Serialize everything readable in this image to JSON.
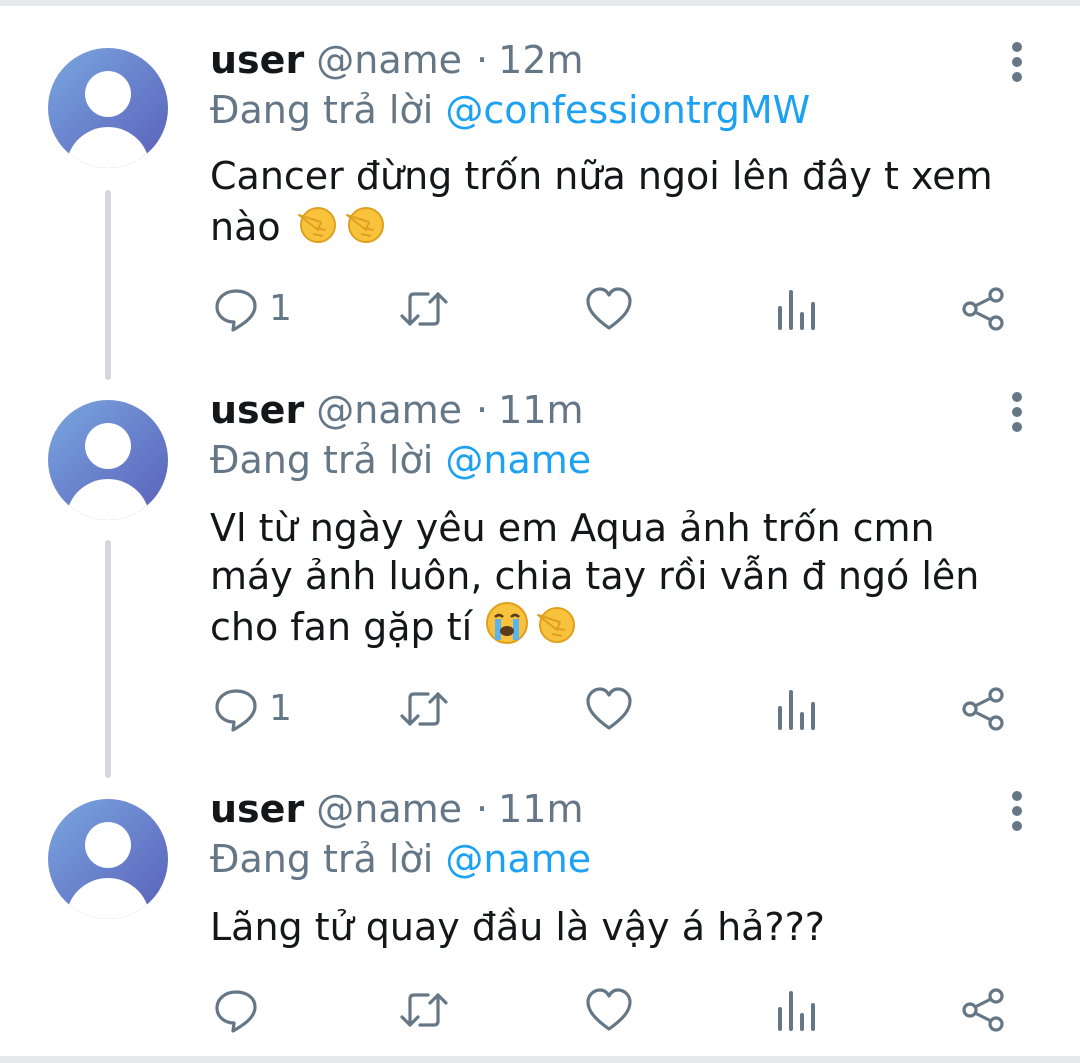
{
  "tweets": [
    {
      "user": "user",
      "handle": "@name",
      "sep": "·",
      "time": "12m",
      "reply_prefix": "Đang trả lời",
      "reply_to": "@confessiontrgMW",
      "text": "Cancer đừng trốn nữa ngoi lên đây t xem nào",
      "emojis": [
        "👉",
        "👉"
      ],
      "reply_count": "1"
    },
    {
      "user": "user",
      "handle": "@name",
      "sep": "·",
      "time": "11m",
      "reply_prefix": "Đang trả lời",
      "reply_to": "@name",
      "text": "Vl từ ngày yêu em Aqua ảnh trốn cmn máy ảnh luôn, chia tay rồi vẫn đ ngó lên cho fan gặp tí",
      "emojis": [
        "😭",
        "👉"
      ],
      "reply_count": "1"
    },
    {
      "user": "user",
      "handle": "@name",
      "sep": "·",
      "time": "11m",
      "reply_prefix": "Đang trả lời",
      "reply_to": "@name",
      "text": "Lãng tử quay đầu là vậy á hả???",
      "emojis": [],
      "reply_count": ""
    }
  ],
  "icons": {
    "reply": "reply-icon",
    "retweet": "retweet-icon",
    "like": "heart-icon",
    "analytics": "analytics-icon",
    "share": "share-icon",
    "more": "more-vertical-icon"
  },
  "colors": {
    "link": "#1da1f2",
    "secondary_text": "#657786",
    "text": "#14171a",
    "divider": "#e6e9ec",
    "avatar_gradient": [
      "#7aa7e0",
      "#5a5fb8"
    ]
  }
}
